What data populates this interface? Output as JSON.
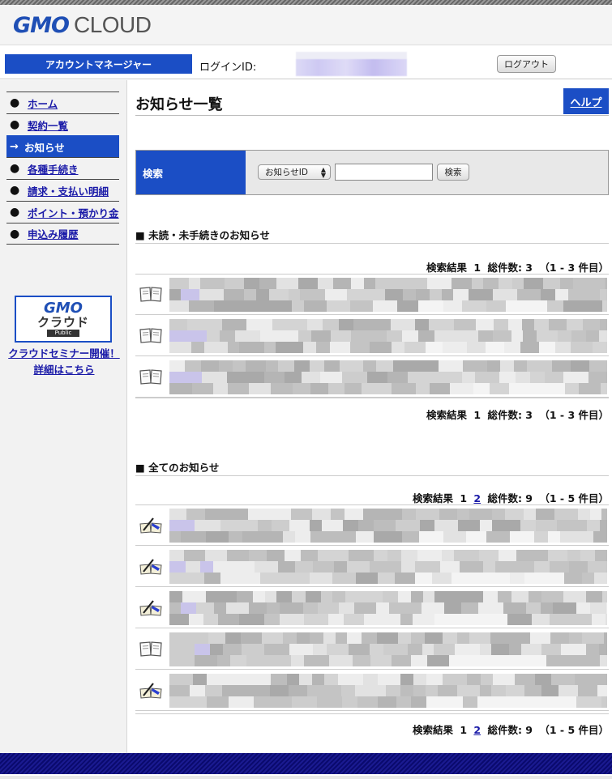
{
  "header": {
    "logo_gmo": "GMO",
    "logo_cloud": "CLOUD"
  },
  "account_bar": {
    "account_manager": "アカウントマネージャー",
    "login_id_label": "ログインID:",
    "logout": "ログアウト"
  },
  "sidebar": {
    "items": [
      {
        "label": "ホーム",
        "icon": "bullet-icon"
      },
      {
        "label": "契約一覧",
        "icon": "bullet-icon"
      },
      {
        "label": "お知らせ",
        "icon": "arrow-right-icon",
        "active": true
      },
      {
        "label": "各種手続き",
        "icon": "bullet-icon"
      },
      {
        "label": "請求・支払い明細",
        "icon": "bullet-icon"
      },
      {
        "label": "ポイント・預かり金",
        "icon": "bullet-icon"
      },
      {
        "label": "申込み履歴",
        "icon": "bullet-icon"
      }
    ],
    "promo": {
      "logo_gmo": "GMO",
      "logo_kura": "クラウド",
      "logo_public": "Public",
      "link_text": "クラウドセミナー開催！詳細はこちら"
    }
  },
  "main": {
    "title": "お知らせ一覧",
    "help": "ヘルプ",
    "search": {
      "label": "検索",
      "select_value": "お知らせID",
      "input_value": "",
      "button": "検索"
    },
    "unread": {
      "heading": "■ 未読・未手続きのお知らせ",
      "result_prefix": "検索結果",
      "pages": [
        "1"
      ],
      "total": "総件数: 3",
      "range": "（1 - 3 件目）",
      "rows": [
        {
          "icon": "book-icon"
        },
        {
          "icon": "book-icon"
        },
        {
          "icon": "book-icon"
        }
      ]
    },
    "all": {
      "heading": "■ 全てのお知らせ",
      "result_prefix": "検索結果",
      "pages": [
        "1",
        "2"
      ],
      "total": "総件数: 9",
      "range": "（1 - 5 件目）",
      "rows": [
        {
          "icon": "read-book-icon"
        },
        {
          "icon": "read-book-icon"
        },
        {
          "icon": "read-book-icon"
        },
        {
          "icon": "book-icon"
        },
        {
          "icon": "read-book-icon"
        }
      ]
    }
  },
  "colors": {
    "accent": "#1b4ec5",
    "link": "#1a1aa8",
    "footer": "#0a0a6e"
  }
}
